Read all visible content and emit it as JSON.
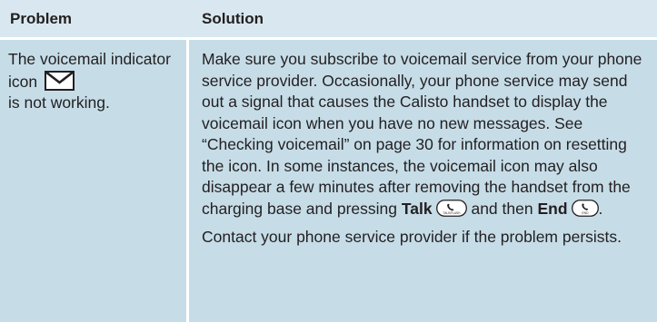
{
  "table": {
    "headers": {
      "problem": "Problem",
      "solution": "Solution"
    },
    "row": {
      "problem": {
        "line_before_icon": "The voicemail indicator icon",
        "icon": "envelope-icon",
        "line_after_icon": "is not working."
      },
      "solution": {
        "para1_text": "Make sure you subscribe to voicemail service from your phone service provider. Occasionally, your phone service may send out a signal that causes the Calisto handset to display the voicemail icon when you have no new messages. See “Checking voicemail” on page 30 for information on resetting the icon. In some instances, the voicemail icon may also disappear a few minutes after removing the handset from the charging base and pressing ",
        "talk_label": "Talk",
        "talk_key_label": "TALK/FLASH",
        "and_then": " and then ",
        "end_label": "End",
        "end_key_label": "END",
        "period": ".",
        "para2_text": "Contact your phone service provider if the problem persists."
      }
    }
  },
  "colors": {
    "header_background": "#d9e8f0",
    "cell_background": "#c6dde8",
    "text": "#231f20"
  }
}
